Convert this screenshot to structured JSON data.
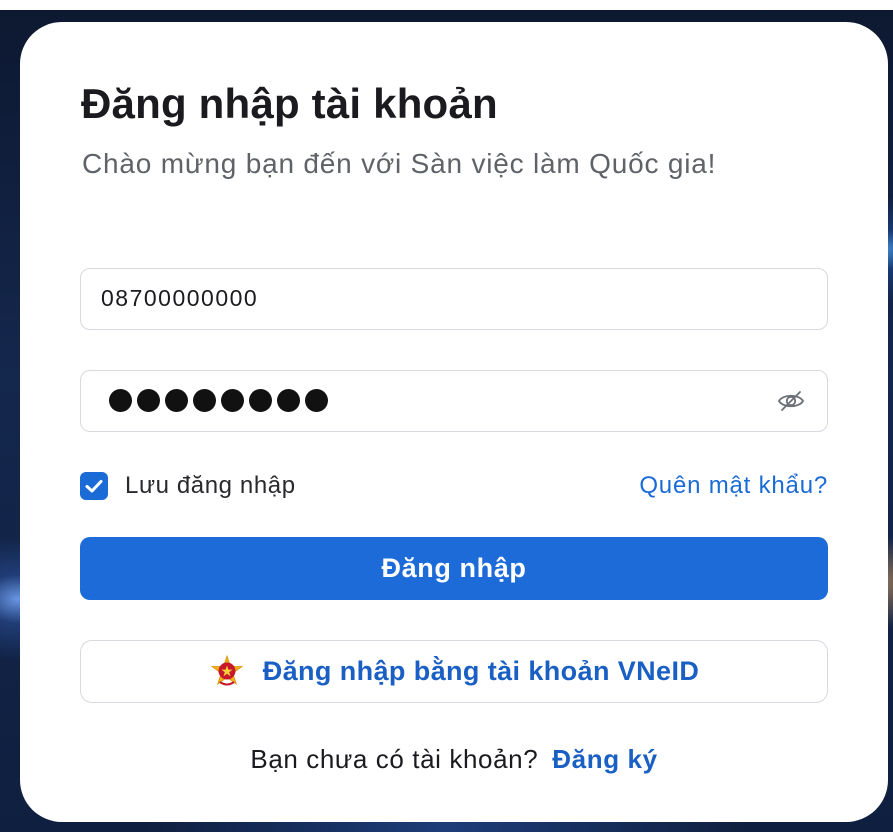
{
  "login_card": {
    "title": "Đăng nhập tài khoản",
    "subtitle": "Chào mừng bạn đến với Sàn việc làm Quốc gia!",
    "phone_field": {
      "value": "08700000000"
    },
    "password_field": {
      "masked_length": 8,
      "toggle_icon": "eye-off-icon"
    },
    "remember": {
      "label": "Lưu đăng nhập",
      "checked": true
    },
    "forgot_password_label": "Quên mật khẩu?",
    "login_button_label": "Đăng nhập",
    "vneid_button": {
      "label": "Đăng nhập bằng tài khoản VNeID",
      "icon": "national-emblem-icon"
    },
    "footer": {
      "prompt": "Bạn chưa có tài khoản?",
      "register_label": "Đăng ký"
    }
  },
  "colors": {
    "primary": "#1c6bd8",
    "link": "#1a5fc4",
    "text": "#1b1b1f",
    "muted": "#5f6368",
    "border": "#d6d9de"
  }
}
